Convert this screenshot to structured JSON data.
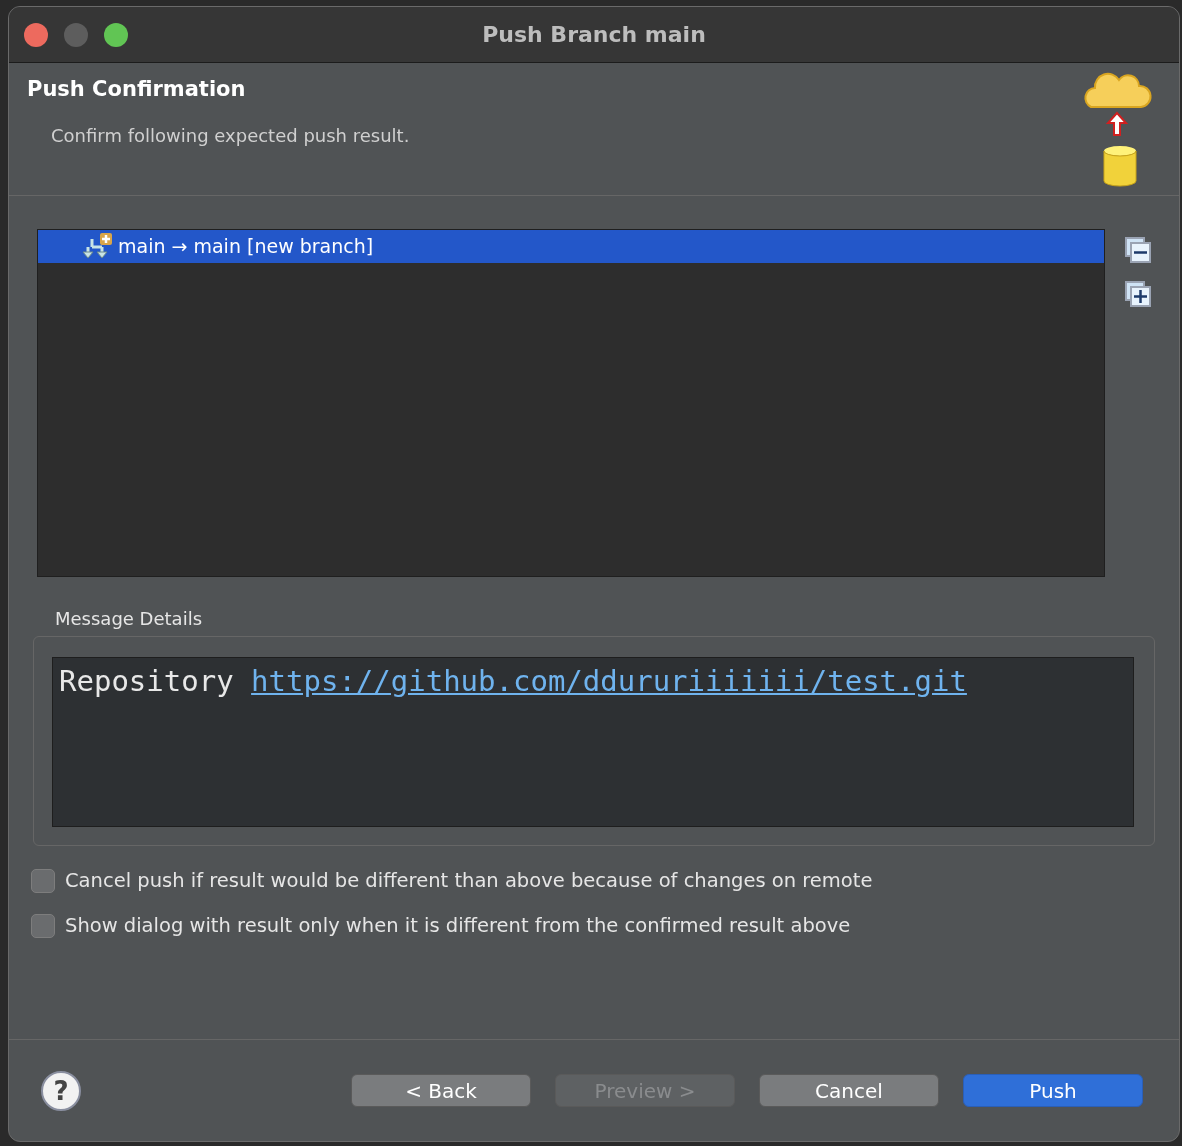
{
  "window": {
    "title": "Push Branch main"
  },
  "header": {
    "title": "Push Confirmation",
    "subtitle": "Confirm following expected push result."
  },
  "tree": {
    "items": [
      {
        "text": "main → main [new branch]",
        "selected": true
      }
    ]
  },
  "message_details": {
    "label": "Message Details",
    "prefix": "Repository",
    "link": "https://github.com/ddururiiiiiii/test.git"
  },
  "options": [
    {
      "label": "Cancel push if result would be different than above because of changes on remote",
      "checked": false
    },
    {
      "label": "Show dialog with result only when it is different from the confirmed result above",
      "checked": false
    }
  ],
  "help": "?",
  "buttons": [
    {
      "label": "< Back",
      "kind": "default",
      "disabled": false
    },
    {
      "label": "Preview >",
      "kind": "default",
      "disabled": true
    },
    {
      "label": "Cancel",
      "kind": "default",
      "disabled": false
    },
    {
      "label": "Push",
      "kind": "primary",
      "disabled": false
    }
  ]
}
